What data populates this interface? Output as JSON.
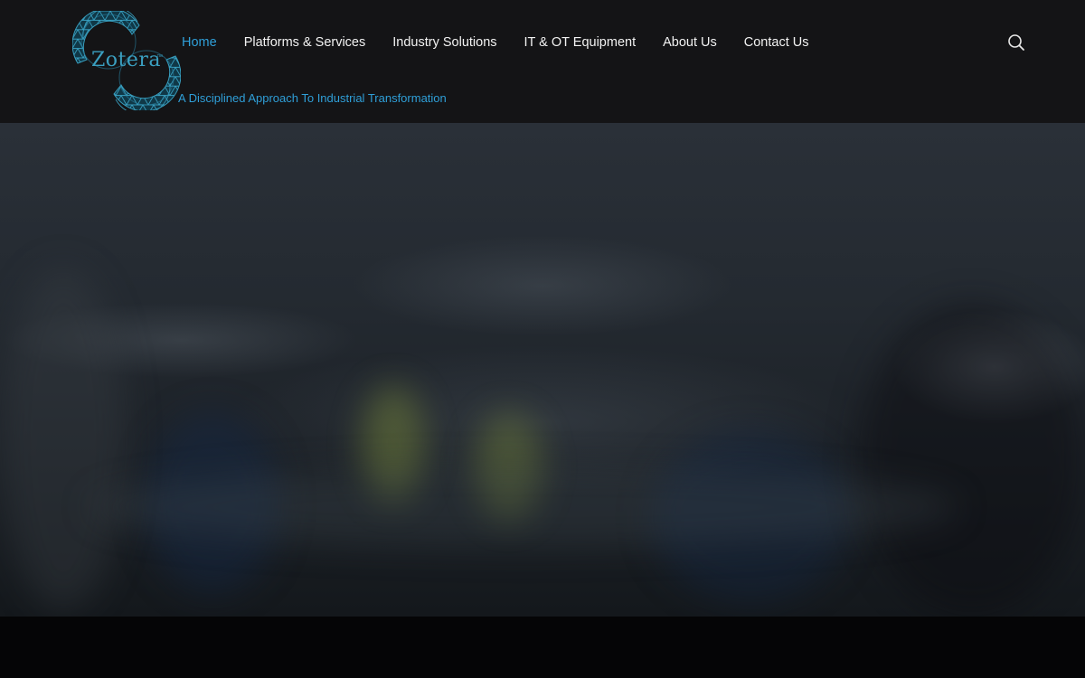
{
  "brand": {
    "name": "Zotera",
    "trademark": "™",
    "tagline": "A Disciplined Approach To Industrial Transformation",
    "accent_color": "#2f9fd8",
    "logo_color": "#3a9fc0"
  },
  "nav": {
    "items": [
      {
        "label": "Home",
        "active": true
      },
      {
        "label": "Platforms & Services",
        "active": false
      },
      {
        "label": "Industry Solutions",
        "active": false
      },
      {
        "label": "IT & OT Equipment",
        "active": false
      },
      {
        "label": "About Us",
        "active": false
      },
      {
        "label": "Contact Us",
        "active": false
      }
    ]
  },
  "header": {
    "search_icon": "search-icon"
  }
}
